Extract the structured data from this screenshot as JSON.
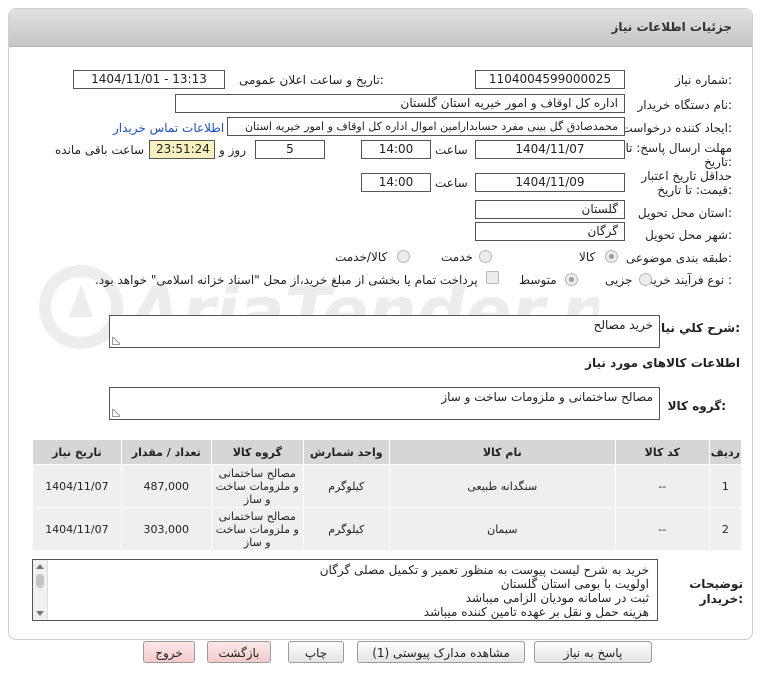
{
  "header": {
    "title": "جزئیات اطلاعات نیاز"
  },
  "fields": {
    "need_number_label": "شماره نیاز:",
    "need_number": "1104004599000025",
    "announce_label": "تاریخ و ساعت اعلان عمومی:",
    "announce_value": "1404/11/01 - 13:13",
    "buyer_org_label": "نام دستگاه خریدار:",
    "buyer_org": "اداره کل اوقاف و امور خیریه استان گلستان",
    "requester_label": "ایجاد کننده درخواست:",
    "requester": "محمدصادق گل بینی مفرد حسابدارامین اموال اداره کل اوقاف و امور خیریه استان",
    "contact_link": "اطلاعات تماس خریدار",
    "deadline_label_1": "مهلت ارسال پاسخ: تا",
    "deadline_label_2": "تاریخ:",
    "deadline_date": "1404/11/07",
    "time_label": "ساعت",
    "deadline_time": "14:00",
    "days_value": "5",
    "days_label": "روز و",
    "remaining_time": "23:51:24",
    "remaining_label": "ساعت باقی مانده",
    "validity_label_1": "حداقل تاریخ اعتبار",
    "validity_label_2": "قیمت: تا تاریخ:",
    "validity_date": "1404/11/09",
    "validity_time": "14:00",
    "province_label": "استان محل تحویل:",
    "province": "گلستان",
    "city_label": "شهر محل تحویل:",
    "city": "گرگان",
    "category_label": "طبقه بندی موضوعی:",
    "category_options": [
      "کالا",
      "خدمت",
      "کالا/خدمت"
    ],
    "process_label": "نوع فرآیند خرید :",
    "process_options": [
      "جزیی",
      "متوسط"
    ],
    "payment_note": "پرداخت تمام یا بخشی از مبلغ خرید،از محل \"اسناد خزانه اسلامی\" خواهد بود."
  },
  "summary": {
    "label": "شرح کلي نياز:",
    "value": "خرید مصالح"
  },
  "goods_info_title": "اطلاعات کالاهای مورد نیاز",
  "goods_group": {
    "label": "گروه کالا:",
    "value": "مصالح ساختمانی و ملزومات ساخت و ساز"
  },
  "table": {
    "headers": [
      "ردیف",
      "کد کالا",
      "نام کالا",
      "واحد شمارش",
      "گروه کالا",
      "تعداد / مقدار",
      "تاریخ نیاز"
    ],
    "rows": [
      {
        "row": "1",
        "code": "--",
        "name": "سنگدانه طبیعی",
        "unit": "کیلوگرم",
        "group": "مصالح ساختمانی و ملزومات ساخت و ساز",
        "qty": "487,000",
        "date": "1404/11/07"
      },
      {
        "row": "2",
        "code": "--",
        "name": "سیمان",
        "unit": "کیلوگرم",
        "group": "مصالح ساختمانی و ملزومات ساخت و ساز",
        "qty": "303,000",
        "date": "1404/11/07"
      }
    ]
  },
  "notes": {
    "label_1": "توضیحات",
    "label_2": "خریدار:",
    "lines": [
      "خرید به شرح لیست پیوست به منظور تعمیر و تکمیل مصلی گرگان",
      "اولویت با بومی استان گلستان",
      "ثبت در سامانه مودیان الزامی میباشد",
      "هزینه حمل و نقل بر عهده تامین کننده میباشد"
    ]
  },
  "buttons": {
    "reply": "پاسخ به نیاز",
    "attachments": "مشاهده مدارک پیوستی (1)",
    "print": "چاپ",
    "back": "بازگشت",
    "exit": "خروج"
  },
  "colors": {
    "link": "#1a4fc9",
    "remaining_bg": "#f8f0bf",
    "pink_button": "#f3caca",
    "watermark": "#e8e8e8"
  }
}
